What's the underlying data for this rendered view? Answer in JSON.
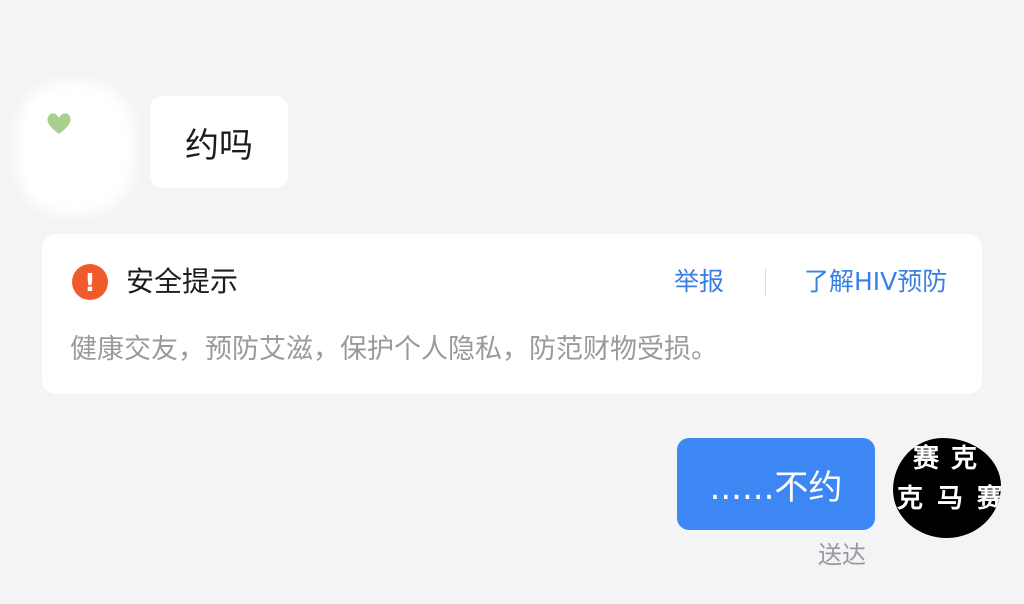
{
  "conversation": {
    "incoming": {
      "text": "约吗"
    },
    "safety_notice": {
      "title": "安全提示",
      "report_label": "举报",
      "learn_label": "了解HIV预防",
      "body": "健康交友，预防艾滋，保护个人隐私，防范财物受损。",
      "icon_color": "#f15a2b",
      "link_color": "#3a7fe6"
    },
    "outgoing": {
      "text": "......不约",
      "status": "送达",
      "bubble_color": "#3d87f5"
    }
  },
  "avatars": {
    "left": {
      "icon": "green-heart-icon"
    },
    "right": {
      "glyphs": [
        "赛",
        "克",
        "克",
        "马",
        "赛"
      ]
    }
  }
}
